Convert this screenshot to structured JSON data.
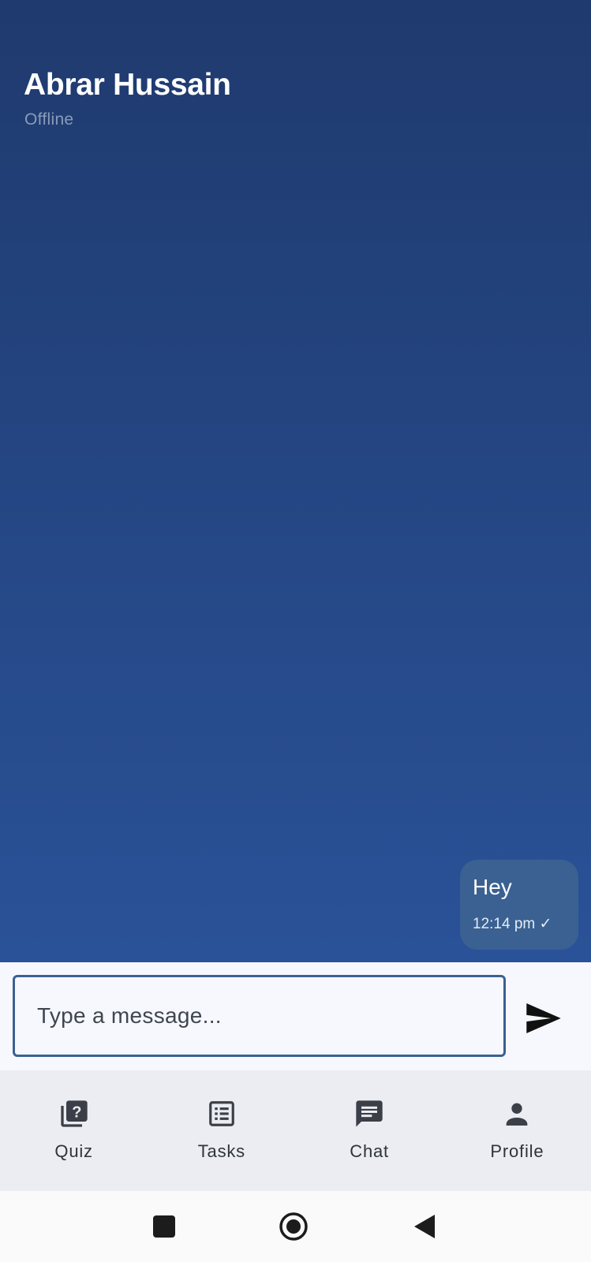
{
  "header": {
    "contact_name": "Abrar Hussain",
    "status": "Offline"
  },
  "messages": [
    {
      "text": "Hey",
      "time": "12:14 pm",
      "receipt": "✓",
      "sender": "me"
    }
  ],
  "composer": {
    "placeholder": "Type a message...",
    "value": "",
    "send_icon": "send-icon"
  },
  "nav": {
    "items": [
      {
        "label": "Quiz",
        "icon": "quiz-icon"
      },
      {
        "label": "Tasks",
        "icon": "list-icon"
      },
      {
        "label": "Chat",
        "icon": "chat-icon"
      },
      {
        "label": "Profile",
        "icon": "person-icon"
      }
    ]
  },
  "system_nav": [
    "square-recents-icon",
    "circle-home-icon",
    "triangle-back-icon"
  ],
  "colors": {
    "background_top": "#1f3a6e",
    "background_bottom": "#2a5298",
    "bubble": "#3a6192",
    "accent": "#3a6192",
    "nav_bg": "#ebedf2"
  }
}
